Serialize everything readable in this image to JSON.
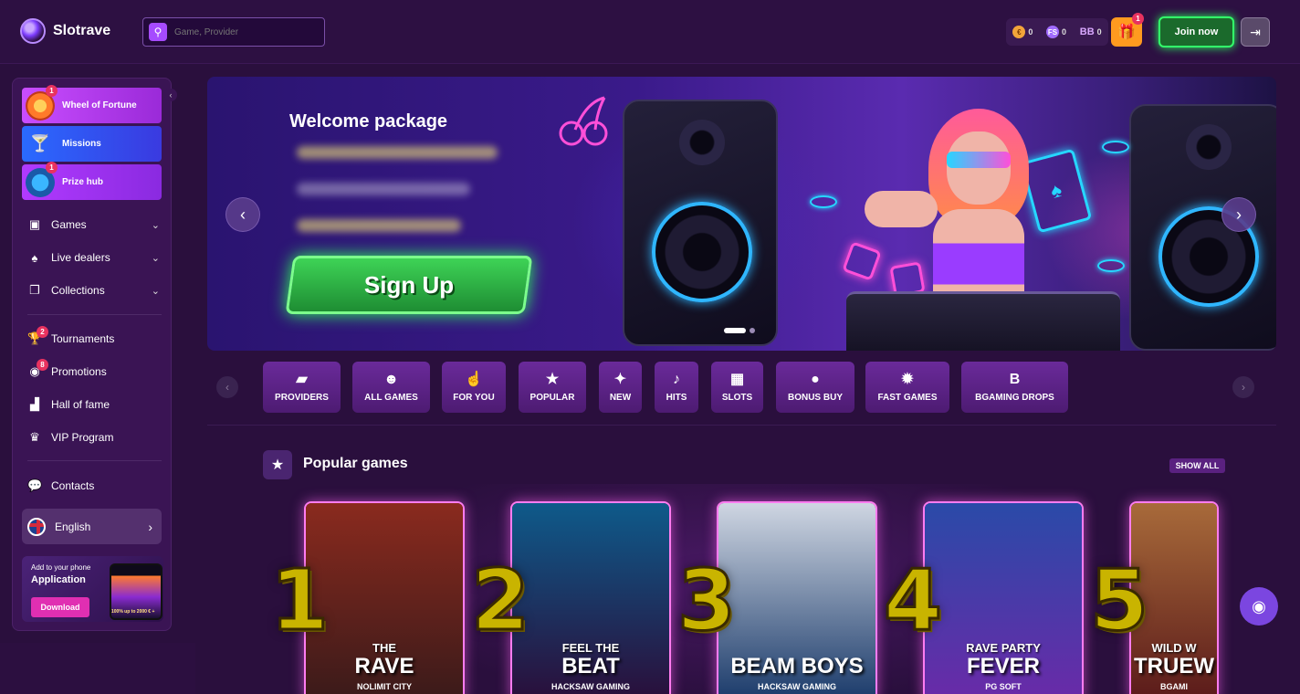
{
  "header": {
    "logo_text": "Slotrave",
    "search_placeholder": "Game, Provider",
    "balances": [
      {
        "icon": "coin-icon",
        "value": "0"
      },
      {
        "icon": "freespins-icon",
        "value": "0"
      },
      {
        "icon": "bb-icon",
        "label": "BB",
        "value": "0"
      }
    ],
    "gift_badge": "1",
    "join_label": "Join now"
  },
  "sidebar": {
    "promo_tiles": [
      {
        "label": "Wheel of Fortune",
        "badge": "1",
        "icon": "wheel-icon"
      },
      {
        "label": "Missions",
        "icon": "cocktail-icon"
      },
      {
        "label": "Prize hub",
        "badge": "1",
        "icon": "treasure-icon"
      }
    ],
    "nav_groups": [
      {
        "label": "Games",
        "icon": "games-icon"
      },
      {
        "label": "Live dealers",
        "icon": "live-dealers-icon"
      },
      {
        "label": "Collections",
        "icon": "collections-icon"
      }
    ],
    "nav_items": [
      {
        "label": "Tournaments",
        "badge": "2",
        "icon": "trophy-icon"
      },
      {
        "label": "Promotions",
        "badge": "8",
        "icon": "promotions-icon"
      },
      {
        "label": "Hall of fame",
        "icon": "podium-icon"
      },
      {
        "label": "VIP Program",
        "icon": "crown-icon"
      }
    ],
    "contacts_label": "Contacts",
    "language": "English",
    "app_promo": {
      "line1": "Add to your phone",
      "line2": "Application",
      "download_label": "Download",
      "phone_text": "100% up to 2000 € +"
    }
  },
  "banner": {
    "welcome_title": "Welcome package",
    "signup_label": "Sign Up",
    "slide_count": 2,
    "active_slide": 1
  },
  "categories": [
    {
      "label": "PROVIDERS",
      "icon": "folder-icon",
      "glyph": "▰"
    },
    {
      "label": "ALL GAMES",
      "icon": "smiley-icon",
      "glyph": "☻"
    },
    {
      "label": "FOR YOU",
      "icon": "pointing-hand-icon",
      "glyph": "☝"
    },
    {
      "label": "POPULAR",
      "icon": "star-icon",
      "glyph": "★"
    },
    {
      "label": "NEW",
      "icon": "sparkle-icon",
      "glyph": "✦"
    },
    {
      "label": "HITS",
      "icon": "microphone-icon",
      "glyph": "♪"
    },
    {
      "label": "SLOTS",
      "icon": "slot-machine-icon",
      "glyph": "▦"
    },
    {
      "label": "BONUS BUY",
      "icon": "coin-icon",
      "glyph": "●"
    },
    {
      "label": "FAST GAMES",
      "icon": "bomb-icon",
      "glyph": "✹"
    },
    {
      "label": "BGAMING DROPS",
      "icon": "bgaming-icon",
      "glyph": "B"
    }
  ],
  "popular": {
    "title": "Popular games",
    "show_all_label": "SHOW ALL",
    "games": [
      {
        "rank": "1",
        "subtitle": "THE",
        "title": "RAVE",
        "provider": "NOLIMIT CITY",
        "colors": [
          "#8a2a1e",
          "#3a1a1a"
        ]
      },
      {
        "rank": "2",
        "subtitle": "FEEL THE",
        "title": "BEAT",
        "provider": "HACKSAW GAMING",
        "colors": [
          "#0e5a8a",
          "#2a0e3a"
        ]
      },
      {
        "rank": "3",
        "subtitle": "",
        "title": "BEAM BOYS",
        "provider": "HACKSAW GAMING",
        "colors": [
          "#cfd6e2",
          "#1a3a6a"
        ]
      },
      {
        "rank": "4",
        "subtitle": "RAVE PARTY",
        "title": "FEVER",
        "provider": "PG SOFT",
        "colors": [
          "#2a4aa8",
          "#6a2aa8"
        ]
      },
      {
        "rank": "5",
        "subtitle": "WILD W",
        "title": "TRUEW",
        "provider": "BGAMI",
        "colors": [
          "#a86a3a",
          "#5a1a1a"
        ]
      }
    ]
  }
}
